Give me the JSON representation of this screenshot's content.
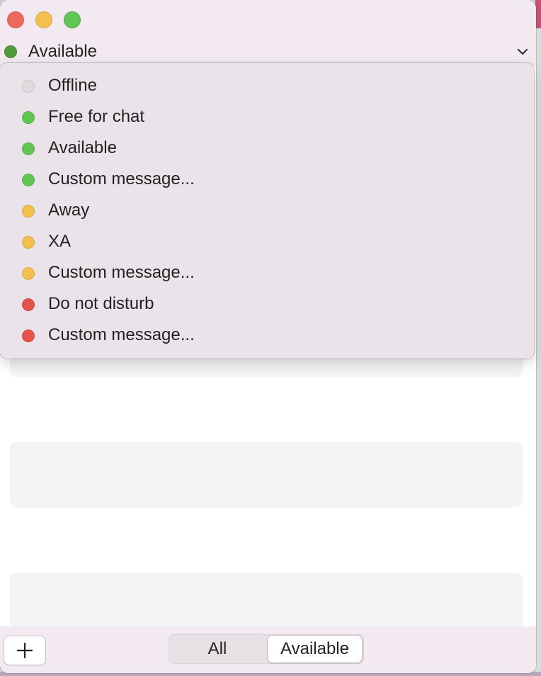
{
  "window": {
    "controls": [
      {
        "name": "close",
        "color": "#ee6a5f"
      },
      {
        "name": "minimize",
        "color": "#f5bf4f"
      },
      {
        "name": "maximize",
        "color": "#61c554"
      }
    ]
  },
  "status": {
    "current": "Available",
    "current_color": "#4f9a3b",
    "chevron_icon": "chevron-down-icon"
  },
  "menu": {
    "items": [
      {
        "label": "Offline",
        "color": "#dcdcdc"
      },
      {
        "label": "Free for chat",
        "color": "#61c554"
      },
      {
        "label": "Available",
        "color": "#61c554"
      },
      {
        "label": "Custom message...",
        "color": "#61c554"
      },
      {
        "label": "Away",
        "color": "#f5bf4f"
      },
      {
        "label": "XA",
        "color": "#f5bf4f"
      },
      {
        "label": "Custom message...",
        "color": "#f5bf4f"
      },
      {
        "label": "Do not disturb",
        "color": "#e5534b"
      },
      {
        "label": "Custom message...",
        "color": "#e5534b"
      }
    ]
  },
  "toolbar": {
    "add_icon": "plus-icon",
    "filter": {
      "options": [
        "All",
        "Available"
      ],
      "selected": "Available"
    }
  }
}
